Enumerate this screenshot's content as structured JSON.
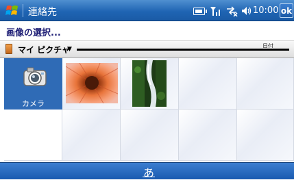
{
  "titlebar": {
    "title": "連絡先",
    "time": "10:00",
    "ok_label": "ok",
    "icons": [
      "windows-start-icon",
      "battery-icon",
      "signal-icon",
      "connectivity-icon",
      "volume-icon"
    ]
  },
  "subtitle": "画像の選択...",
  "filter": {
    "folder": "マイ ピクチャ",
    "sort_label": "日付"
  },
  "grid": {
    "camera_label": "カメラ",
    "thumbnails": [
      "flower-thumbnail",
      "waterfall-thumbnail"
    ]
  },
  "bottombar": {
    "input_label": "あ"
  },
  "colors": {
    "titlebar": "#1f64b3",
    "camera_tile": "#2f6bb6",
    "subtitle_text": "#1d1d75"
  }
}
